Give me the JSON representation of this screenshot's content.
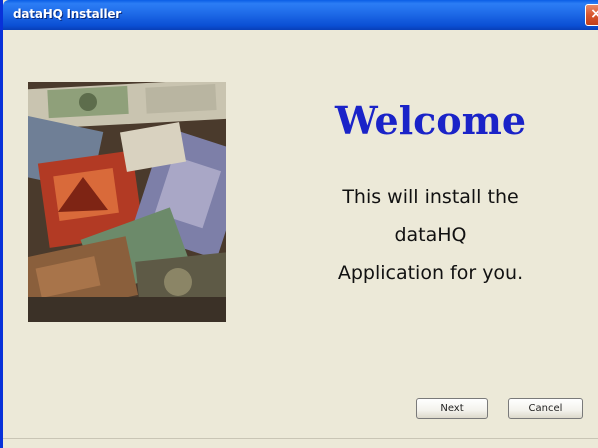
{
  "window": {
    "title": "dataHQ Installer",
    "close_glyph": "×"
  },
  "hero": {
    "image_description_icon": "banknotes-image"
  },
  "main": {
    "heading": "Welcome",
    "message_lines": [
      "This will install the",
      "dataHQ",
      "Application for you."
    ]
  },
  "buttons": {
    "next": "Next",
    "cancel": "Cancel"
  },
  "colors": {
    "titlebar": "#0b4fd4",
    "heading": "#1a23c8",
    "background": "#ece9d8",
    "close": "#d8552e"
  }
}
